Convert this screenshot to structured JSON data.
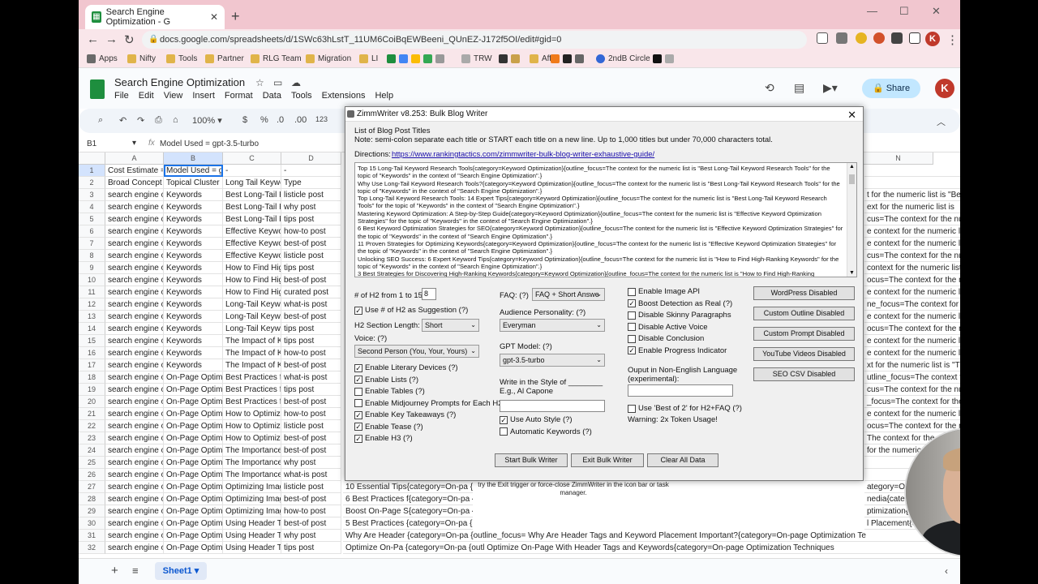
{
  "browser": {
    "tab_title": "Search Engine Optimization - G",
    "url": "docs.google.com/spreadsheets/d/1SWc63hLstT_11UM6CoiBqEWBeeni_QUnEZ-J172f5OI/edit#gid=0",
    "bookmarks": [
      "Apps",
      "Nifty",
      "Tools",
      "Partner",
      "RLG Team",
      "Migration",
      "LI",
      "TRW",
      "Aff",
      "2ndB Circle"
    ],
    "profile_initial": "K"
  },
  "sheets": {
    "title": "Search Engine Optimization",
    "menu": [
      "File",
      "Edit",
      "View",
      "Insert",
      "Format",
      "Data",
      "Tools",
      "Extensions",
      "Help"
    ],
    "share_label": "Share",
    "zoom": "100%",
    "font_size": "123",
    "name_box": "B1",
    "formula": "Model Used = gpt-3.5-turbo",
    "columns": [
      "A",
      "B",
      "C",
      "D",
      "N"
    ],
    "sheet_tab": "Sheet1"
  },
  "rows": [
    {
      "n": "1",
      "a": "Cost Estimate =",
      "b": "Model Used = g",
      "c": "-",
      "d": "-",
      "r": ""
    },
    {
      "n": "2",
      "a": "Broad Concept",
      "b": "Topical Cluster",
      "c": "Long Tail Keywo",
      "d": "Type",
      "r": ""
    },
    {
      "n": "3",
      "a": "search engine o",
      "b": "Keywords",
      "c": "Best Long-Tail K",
      "d": "listicle post",
      "r": "t for the numeric list is \"Be"
    },
    {
      "n": "4",
      "a": "search engine o",
      "b": "Keywords",
      "c": "Best Long-Tail K",
      "d": "why post",
      "r": "ext for the numeric list is"
    },
    {
      "n": "5",
      "a": "search engine o",
      "b": "Keywords",
      "c": "Best Long-Tail K",
      "d": "tips post",
      "r": "cus=The context for the num"
    },
    {
      "n": "6",
      "a": "search engine o",
      "b": "Keywords",
      "c": "Effective Keywo",
      "d": "how-to post",
      "r": "e context for the numeric lis"
    },
    {
      "n": "7",
      "a": "search engine o",
      "b": "Keywords",
      "c": "Effective Keywo",
      "d": "best-of post",
      "r": "e context for the numeric list"
    },
    {
      "n": "8",
      "a": "search engine o",
      "b": "Keywords",
      "c": "Effective Keywo",
      "d": "listicle post",
      "r": "cus=The context for the num"
    },
    {
      "n": "9",
      "a": "search engine o",
      "b": "Keywords",
      "c": "How to Find Higl",
      "d": "tips post",
      "r": "context for the numeric list"
    },
    {
      "n": "10",
      "a": "search engine o",
      "b": "Keywords",
      "c": "How to Find Higl",
      "d": "best-of post",
      "r": "ocus=The context for the nu"
    },
    {
      "n": "11",
      "a": "search engine o",
      "b": "Keywords",
      "c": "How to Find Higl",
      "d": "curated post",
      "r": "e context for the numeric list"
    },
    {
      "n": "12",
      "a": "search engine o",
      "b": "Keywords",
      "c": "Long-Tail Keywo",
      "d": "what-is post",
      "r": "ne_focus=The context for th"
    },
    {
      "n": "13",
      "a": "search engine o",
      "b": "Keywords",
      "c": "Long-Tail Keywo",
      "d": "best-of post",
      "r": "e context for the numeric list"
    },
    {
      "n": "14",
      "a": "search engine o",
      "b": "Keywords",
      "c": "Long-Tail Keywo",
      "d": "tips post",
      "r": "ocus=The context for the nu"
    },
    {
      "n": "15",
      "a": "search engine o",
      "b": "Keywords",
      "c": "The Impact of K",
      "d": "tips post",
      "r": "e context for the numeric lis"
    },
    {
      "n": "16",
      "a": "search engine o",
      "b": "Keywords",
      "c": "The Impact of K",
      "d": "how-to post",
      "r": "e context for the numeric lis"
    },
    {
      "n": "17",
      "a": "search engine o",
      "b": "Keywords",
      "c": "The Impact of K",
      "d": "best-of post",
      "r": "xt for the numeric list is \"Th"
    },
    {
      "n": "18",
      "a": "search engine o",
      "b": "On-Page Optimi",
      "c": "Best Practices fo",
      "d": "what-is post",
      "r": "utline_focus=The context for"
    },
    {
      "n": "19",
      "a": "search engine o",
      "b": "On-Page Optimi",
      "c": "Best Practices fo",
      "d": "tips post",
      "r": "cus=The context for the nume"
    },
    {
      "n": "20",
      "a": "search engine o",
      "b": "On-Page Optimi",
      "c": "Best Practices fo",
      "d": "best-of post",
      "r": "_focus=The context for the n"
    },
    {
      "n": "21",
      "a": "search engine o",
      "b": "On-Page Optimi",
      "c": "How to Optimize",
      "d": "how-to post",
      "r": "e context for the numeric list"
    },
    {
      "n": "22",
      "a": "search engine o",
      "b": "On-Page Optimi",
      "c": "How to Optimize",
      "d": "listicle post",
      "r": "ocus=The context for the nu"
    },
    {
      "n": "23",
      "a": "search engine o",
      "b": "On-Page Optimi",
      "c": "How to Optimize",
      "d": "best-of post",
      "r": "The context for the numeric"
    },
    {
      "n": "24",
      "a": "search engine o",
      "b": "On-Page Optimi",
      "c": "The Importance",
      "d": "best-of post",
      "r": "for the numeric list is"
    },
    {
      "n": "25",
      "a": "search engine o",
      "b": "On-Page Optimi",
      "c": "The Importance",
      "d": "why post",
      "r": ""
    },
    {
      "n": "26",
      "a": "search engine o",
      "b": "On-Page Optimi",
      "c": "The Importance",
      "d": "what-is post",
      "r": ""
    },
    {
      "n": "27",
      "a": "search engine o",
      "b": "On-Page Optimi",
      "c": "Optimizing Imag",
      "d": "listicle post",
      "r": "ategory=On-page Optimization Techniques"
    },
    {
      "n": "28",
      "a": "search engine o",
      "b": "On-Page Optimi",
      "c": "Optimizing Imag",
      "d": "best-of post",
      "r": "nedia{category=On-page Optimization Techn"
    },
    {
      "n": "29",
      "a": "search engine o",
      "b": "On-Page Optimi",
      "c": "Optimizing Imag",
      "d": "how-to post",
      "r": "ptimization{category=On-page Optimization Te"
    },
    {
      "n": "30",
      "a": "search engine o",
      "b": "On-Page Optimi",
      "c": "Using Header T",
      "d": "best-of post",
      "r": "l Placement{category=On-page Optimization T"
    },
    {
      "n": "31",
      "a": "search engine o",
      "b": "On-Page Optimi",
      "c": "Using Header T",
      "d": "why post",
      "r": ""
    },
    {
      "n": "32",
      "a": "search engine o",
      "b": "On-Page Optimi",
      "c": "Using Header T",
      "d": "tips post",
      "r": ""
    }
  ],
  "right_cols": {
    "r27": "10 Essential Tips{category=On-pa {outl",
    "r28": "6 Best Practices f{category=On-pa {outl",
    "r29": "Boost On-Page S{category=On-pa {outl",
    "r30": "5 Best Practices {category=On-pa {outl",
    "r31": "Why Are Header {category=On-pa {outline_focus= Why Are Header Tags and Keyword Placement Important?{category=On-page Optimization Te",
    "r32": "Optimize On-Pa {category=On-pa {outl Optimize On-Page With Header Tags and Keywords{category=On-page Optimization Techniques"
  },
  "dialog": {
    "title": "ZimmWriter v8.253: Bulk Blog Writer",
    "list_heading": "List of Blog Post Titles",
    "note": "Note: semi-colon separate each title or START each title on a new line. Up to 1,000 titles but under 70,000 characters total.",
    "directions_label": "Directions:",
    "directions_link": "https://www.rankingtactics.com/zimmwriter-bulk-blog-writer-exhaustive-guide/",
    "titles_text": [
      "Top 15 Long-Tail Keyword Research Tools{category=Keyword Optimization}{outline_focus=The context for the numeric list is \"Best Long-Tail Keyword Research Tools\" for the",
      "topic of \"Keywords\" in the context of \"Search Engine Optimization\".}",
      "Why Use Long-Tail Keyword Research Tools?{category=Keyword Optimization}{outline_focus=The context for the numeric list is \"Best Long-Tail Keyword Research Tools\" for the",
      "topic of \"Keywords\" in the context of \"Search Engine Optimization\".}",
      "Top Long-Tail Keyword Research Tools: 14 Expert Tips{category=Keyword Optimization}{outline_focus=The context for the numeric list is \"Best Long-Tail Keyword Research",
      "Tools\" for the topic of \"Keywords\" in the context of \"Search Engine Optimization\".}",
      "Mastering Keyword Optimization: A Step-by-Step Guide{category=Keyword Optimization}{outline_focus=The context for the numeric list is \"Effective Keyword Optimization",
      "Strategies\" for the topic of \"Keywords\" in the context of \"Search Engine Optimization\".}",
      "6 Best Keyword Optimization Strategies for SEO{category=Keyword Optimization}{outline_focus=The context for the numeric list is \"Effective Keyword Optimization Strategies\" for",
      "the topic of \"Keywords\" in the context of \"Search Engine Optimization\".}",
      "11 Proven Strategies for Optimizing Keywords{category=Keyword Optimization}{outline_focus=The context for the numeric list is \"Effective Keyword Optimization Strategies\" for",
      "the topic of \"Keywords\" in the context of \"Search Engine Optimization\".}",
      "Unlocking SEO Success: 6 Expert Keyword Tips{category=Keyword Optimization}{outline_focus=The context for the numeric list is \"How to Find High-Ranking Keywords\" for the",
      "topic of \"Keywords\" in the context of \"Search Engine Optimization\".}",
      "3 Best Strategies for Discovering High-Ranking Keywords{category=Keyword Optimization}{outline_focus=The context for the numeric list is \"How to Find High-Ranking"
    ],
    "h2_count_label": "# of H2 from 1 to 15:",
    "h2_count_value": "8",
    "use_h2_suggestion": "Use # of H2 as Suggestion (?)",
    "h2_length_label": "H2 Section Length:",
    "h2_length_value": "Short",
    "voice_label": "Voice: (?)",
    "voice_value": "Second Person (You, Your, Yours)",
    "left_checks": [
      {
        "label": "Enable Literary Devices (?)",
        "checked": "✓"
      },
      {
        "label": "Enable Lists (?)",
        "checked": "✓"
      },
      {
        "label": "Enable Tables (?)",
        "checked": ""
      },
      {
        "label": "Enable Midjourney Prompts for Each H2",
        "checked": ""
      },
      {
        "label": "Enable Key Takeaways (?)",
        "checked": "✓"
      },
      {
        "label": "Enable Tease (?)",
        "checked": "✓"
      },
      {
        "label": "Enable H3 (?)",
        "checked": "✓"
      }
    ],
    "faq_label": "FAQ: (?)",
    "faq_value": "FAQ + Short Answe",
    "personality_label": "Audience Personality: (?)",
    "personality_value": "Everyman",
    "gpt_label": "GPT Model: (?)",
    "gpt_value": "gpt-3.5-turbo",
    "style_label": "Write in the Style of ________",
    "style_example": "E.g., Al Capone",
    "mid_checks": [
      {
        "label": "Use Auto Style (?)",
        "checked": "✓"
      },
      {
        "label": "Automatic Keywords (?)",
        "checked": ""
      }
    ],
    "right_checks": [
      {
        "label": "Enable Image API",
        "checked": ""
      },
      {
        "label": "Boost Detection as Real (?)",
        "checked": "✓"
      },
      {
        "label": "Disable Skinny Paragraphs",
        "checked": ""
      },
      {
        "label": "Disable Active Voice",
        "checked": ""
      },
      {
        "label": "Disable Conclusion",
        "checked": ""
      },
      {
        "label": "Enable Progress Indicator",
        "checked": "✓"
      }
    ],
    "nonenglish_label": "Ouput in Non-English Language (experimental):",
    "best_of_2": "Use 'Best of 2' for H2+FAQ (?)",
    "warning": "Warning: 2x Token Usage!",
    "side_buttons": [
      "WordPress Disabled",
      "Custom Outline Disabled",
      "Custom Prompt Disabled",
      "YouTube Videos Disabled",
      "SEO CSV Disabled"
    ],
    "bottom_buttons": [
      "Start Bulk Writer",
      "Exit Bulk Writer",
      "Clear All Data"
    ],
    "hint_below": "try the Exit trigger or force-close ZimmWriter in the icon bar or task manager."
  }
}
